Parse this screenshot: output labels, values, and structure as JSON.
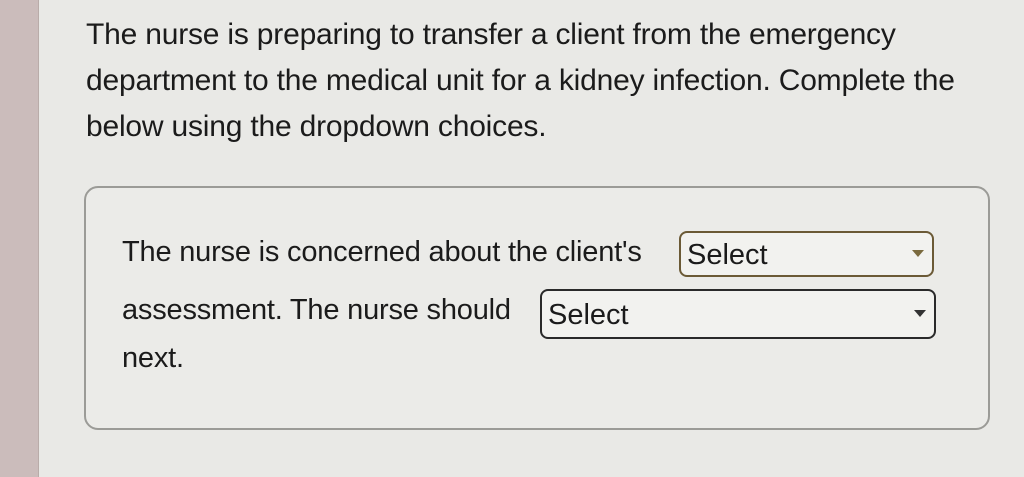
{
  "question": {
    "line_1": "The nurse is preparing to transfer a client from the emergency",
    "line_2": "department to the medical unit for a kidney infection. Complete the",
    "line_3": "below using the dropdown choices."
  },
  "answer": {
    "text_before_select_1": "The nurse is concerned about the client's",
    "text_before_select_2": "assessment. The nurse should",
    "text_after_select_2": "next.",
    "select_1": {
      "value": "Select",
      "icon": "chevron-down-icon"
    },
    "select_2": {
      "value": "Select",
      "icon": "chevron-down-icon"
    }
  },
  "colors": {
    "background": "#e9e9e6",
    "left_strip": "#cbbcbb",
    "box_border": "#9b9b97",
    "select_1_border": "#6b5a36",
    "select_2_border": "#2a2a2a"
  }
}
